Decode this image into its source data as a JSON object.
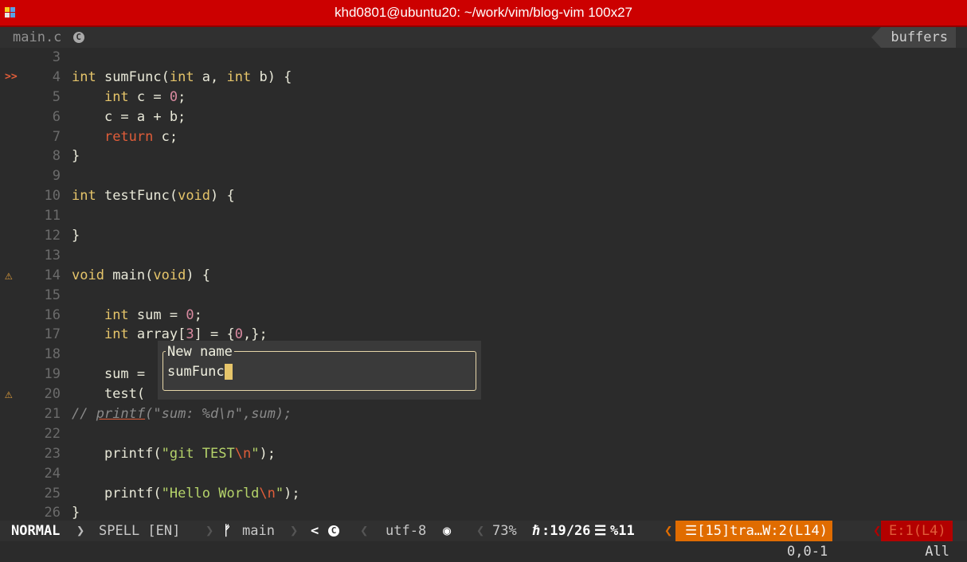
{
  "window": {
    "title": "khd0801@ubuntu20: ~/work/vim/blog-vim 100x27"
  },
  "tabline": {
    "filename": "main.c",
    "file_icon": "c-language-icon",
    "buffers_label": "buffers"
  },
  "lines": [
    {
      "num": "3",
      "sign": ""
    },
    {
      "num": "4",
      "sign": ">>"
    },
    {
      "num": "5",
      "sign": ""
    },
    {
      "num": "6",
      "sign": ""
    },
    {
      "num": "7",
      "sign": ""
    },
    {
      "num": "8",
      "sign": ""
    },
    {
      "num": "9",
      "sign": ""
    },
    {
      "num": "10",
      "sign": ""
    },
    {
      "num": "11",
      "sign": ""
    },
    {
      "num": "12",
      "sign": ""
    },
    {
      "num": "13",
      "sign": ""
    },
    {
      "num": "14",
      "sign": "⚠"
    },
    {
      "num": "15",
      "sign": ""
    },
    {
      "num": "16",
      "sign": ""
    },
    {
      "num": "17",
      "sign": ""
    },
    {
      "num": "18",
      "sign": ""
    },
    {
      "num": "19",
      "sign": ""
    },
    {
      "num": "20",
      "sign": "⚠"
    },
    {
      "num": "21",
      "sign": ""
    },
    {
      "num": "22",
      "sign": ""
    },
    {
      "num": "23",
      "sign": ""
    },
    {
      "num": "24",
      "sign": ""
    },
    {
      "num": "25",
      "sign": ""
    },
    {
      "num": "26",
      "sign": ""
    }
  ],
  "code": {
    "l4_kw": "int",
    "l4_fn": " sumFunc(",
    "l4_kw2": "int",
    "l4_a": " a, ",
    "l4_kw3": "int",
    "l4_b": " b) {",
    "l5_indent": "    ",
    "l5_kw": "int",
    "l5_rest": " c = ",
    "l5_num": "0",
    "l5_end": ";",
    "l6": "    c = a + b;",
    "l7_indent": "    ",
    "l7_kw": "return",
    "l7_rest": " c;",
    "l8": "}",
    "l10_kw": "int",
    "l10_fn": " testFunc(",
    "l10_kw2": "void",
    "l10_end": ") {",
    "l12": "}",
    "l14_kw": "void",
    "l14_fn": " main(",
    "l14_kw2": "void",
    "l14_end": ") {",
    "l16_indent": "    ",
    "l16_kw": "int",
    "l16_rest": " sum = ",
    "l16_num": "0",
    "l16_end": ";",
    "l17_indent": "    ",
    "l17_kw": "int",
    "l17_rest": " array[",
    "l17_num": "3",
    "l17_mid": "] = {",
    "l17_num2": "0",
    "l17_end": ",};",
    "l19": "    sum = ",
    "l20": "    test(",
    "l21_a": "// ",
    "l21_fn": "printf",
    "l21_rest": "(\"sum: %d\\n\",sum);",
    "l23_a": "    printf(",
    "l23_str": "\"git TEST",
    "l23_esc": "\\n",
    "l23_str2": "\"",
    "l23_end": ");",
    "l25_a": "    printf(",
    "l25_str": "\"Hello World",
    "l25_esc": "\\n",
    "l25_str2": "\"",
    "l25_end": ");",
    "l26": "}"
  },
  "rename_popup": {
    "title": "New name",
    "value": "sumFunc"
  },
  "statusline": {
    "mode": "NORMAL",
    "spell": "SPELL [EN]",
    "branch_icon": "git-branch-icon",
    "branch": "main",
    "filetype_prefix": "<",
    "filetype_icon": "c-language-icon",
    "encoding": "utf-8",
    "format_icon": "os-icon",
    "percent": "73%",
    "line_col": ":19/26",
    "col": "%11",
    "warnings": "☰[15]tra…W:2(L14)",
    "errors": "E:1(L4)"
  },
  "cmdline": {
    "position": "0,0-1",
    "scroll": "All"
  }
}
